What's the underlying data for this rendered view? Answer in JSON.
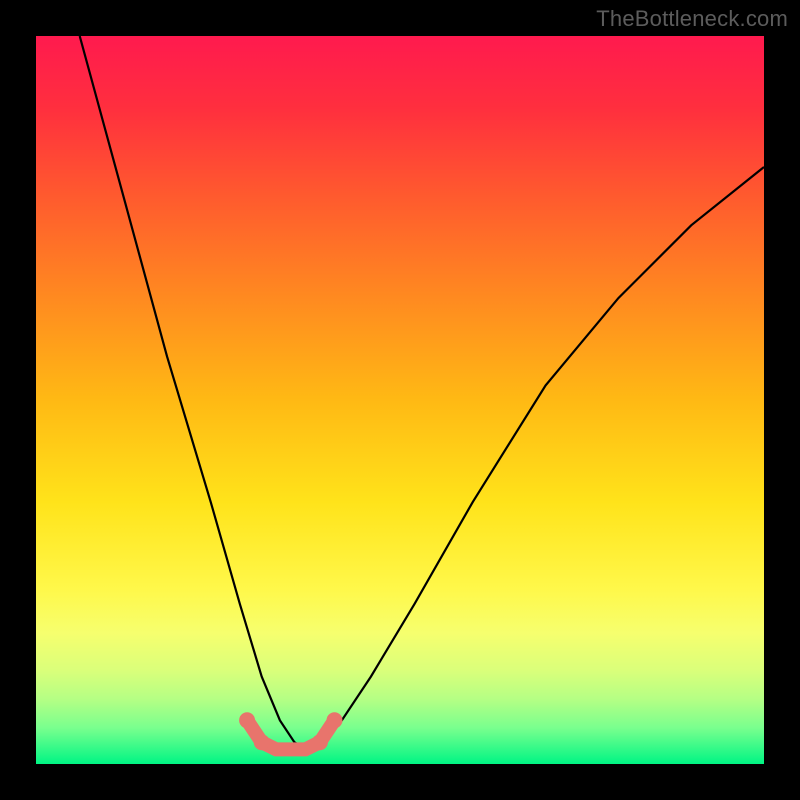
{
  "watermark_text": "TheBottleneck.com",
  "chart_data": {
    "type": "line",
    "title": "",
    "xlabel": "",
    "ylabel": "",
    "xlim": [
      0,
      100
    ],
    "ylim": [
      0,
      100
    ],
    "grid": false,
    "series": [
      {
        "name": "curve",
        "x": [
          6,
          12,
          18,
          24,
          28,
          31,
          33.5,
          35.5,
          37,
          39.5,
          42,
          46,
          52,
          60,
          70,
          80,
          90,
          100
        ],
        "y": [
          100,
          78,
          56,
          36,
          22,
          12,
          6,
          3,
          2,
          3,
          6,
          12,
          22,
          36,
          52,
          64,
          74,
          82
        ],
        "color": "#000000"
      }
    ],
    "floor_marker": {
      "x": [
        29,
        31,
        33,
        35,
        37,
        39,
        41
      ],
      "y": [
        6,
        3,
        2,
        2,
        2,
        3,
        6
      ],
      "color": "#e8746c"
    },
    "background_gradient": {
      "stops": [
        {
          "pos": 0.0,
          "color": "#ff1a4e"
        },
        {
          "pos": 0.1,
          "color": "#ff2f3e"
        },
        {
          "pos": 0.22,
          "color": "#ff5a2e"
        },
        {
          "pos": 0.36,
          "color": "#ff8a20"
        },
        {
          "pos": 0.5,
          "color": "#ffb914"
        },
        {
          "pos": 0.64,
          "color": "#ffe31a"
        },
        {
          "pos": 0.76,
          "color": "#fff84a"
        },
        {
          "pos": 0.82,
          "color": "#f6ff6e"
        },
        {
          "pos": 0.87,
          "color": "#dbff7a"
        },
        {
          "pos": 0.91,
          "color": "#b6ff84"
        },
        {
          "pos": 0.95,
          "color": "#7aff8e"
        },
        {
          "pos": 1.0,
          "color": "#00f584"
        }
      ]
    }
  }
}
